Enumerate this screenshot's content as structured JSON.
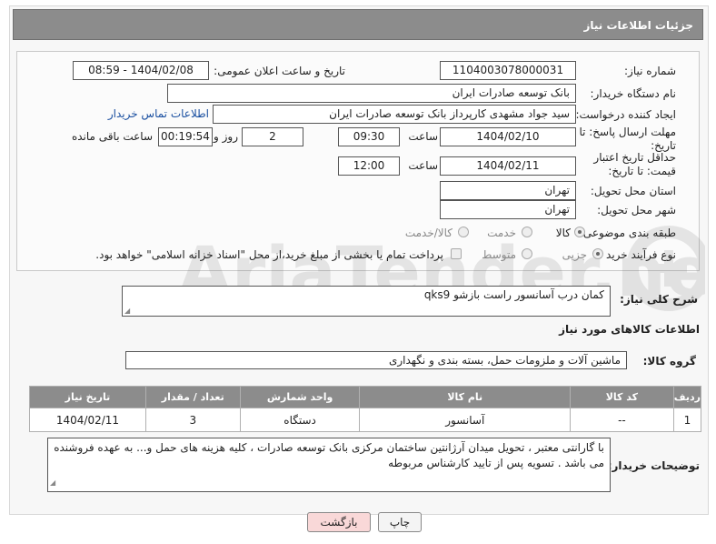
{
  "header": {
    "title": "جزئیات اطلاعات نیاز"
  },
  "fields": {
    "need_number_label": "شماره نیاز:",
    "need_number": "1104003078000031",
    "announce_label": "تاریخ و ساعت اعلان عمومی:",
    "announce_value": "1404/02/08 - 08:59",
    "buyer_org_label": "نام دستگاه خریدار:",
    "buyer_org": "بانک توسعه صادرات ایران",
    "creator_label": "ایجاد کننده درخواست:",
    "creator": "سید جواد مشهدی کارپرداز بانک توسعه صادرات ایران",
    "contact_link": "اطلاعات تماس خریدار",
    "reply_deadline_label": "مهلت ارسال پاسخ: تا تاریخ:",
    "reply_date": "1404/02/10",
    "time_label": "ساعت",
    "reply_time": "09:30",
    "days_value": "2",
    "days_label": "روز و",
    "remaining_time": "00:19:54",
    "remaining_label": "ساعت باقی مانده",
    "validity_label": "حداقل تاریخ اعتبار قیمت: تا تاریخ:",
    "validity_date": "1404/02/11",
    "validity_time": "12:00",
    "province_label": "استان محل تحویل:",
    "province": "تهران",
    "city_label": "شهر محل تحویل:",
    "city": "تهران",
    "category_label": "طبقه بندی موضوعی:",
    "category_options": [
      "کالا",
      "خدمت",
      "کالا/خدمت"
    ],
    "process_label": "نوع فرآیند خرید :",
    "process_options": [
      "جزیی",
      "متوسط"
    ],
    "payment_note": "پرداخت تمام یا بخشی از مبلغ خرید،از محل \"اسناد خزانه اسلامی\" خواهد بود."
  },
  "description": {
    "label": "شرح کلی نیاز:",
    "value": "کمان درب آسانسور راست بازشو qks9"
  },
  "goods": {
    "section_title": "اطلاعات کالاهای مورد نیاز",
    "group_label": "گروه کالا:",
    "group_value": "ماشین آلات و ملزومات حمل، بسته بندی و نگهداری"
  },
  "table": {
    "headers": [
      "ردیف",
      "کد کالا",
      "نام کالا",
      "واحد شمارش",
      "تعداد / مقدار",
      "تاریخ نیاز"
    ],
    "rows": [
      [
        "1",
        "--",
        "آسانسور",
        "دستگاه",
        "3",
        "1404/02/11"
      ]
    ]
  },
  "buyer_notes": {
    "label": "توضیحات خریدار:",
    "value": "با گارانتی معتبر ، تحویل میدان آرژانتین ساختمان مرکزی بانک توسعه صادرات ، کلیه هزینه های حمل و... به عهده فروشنده می باشد . تسویه پس از تایید کارشناس مربوطه"
  },
  "buttons": {
    "print": "چاپ",
    "back": "بازگشت"
  },
  "watermark": "AriaTender.net",
  "colors": {
    "header_bg": "#8c8c8c",
    "link": "#1a4fa0",
    "back_button_bg": "#f9d8d8"
  }
}
